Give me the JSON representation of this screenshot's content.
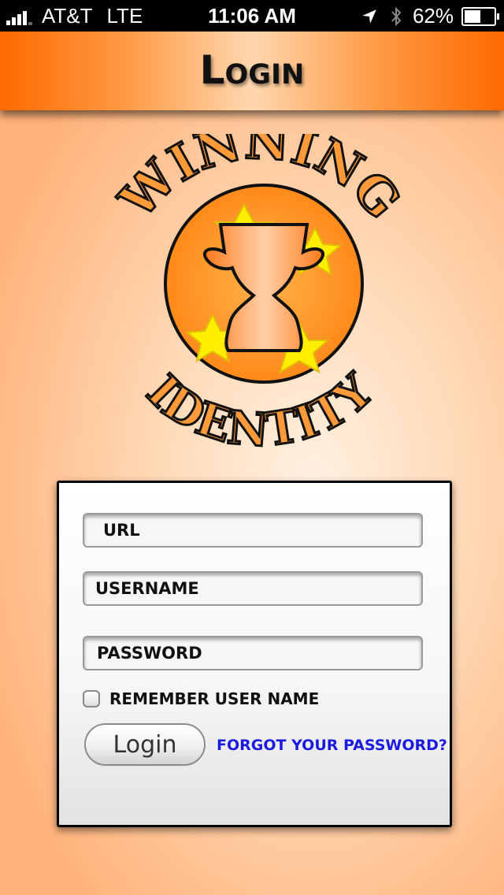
{
  "status_bar": {
    "carrier": "AT&T",
    "network": "LTE",
    "time": "11:06 AM",
    "battery": "62%",
    "battery_level": 0.62,
    "icons": [
      "signal-icon",
      "location-icon",
      "bluetooth-icon",
      "battery-icon"
    ]
  },
  "header": {
    "title": "Login"
  },
  "logo": {
    "name": "Winning Identity",
    "colors": {
      "orange": "#ff8a1a",
      "yellow": "#ffee00",
      "outline": "#111111"
    }
  },
  "form": {
    "url_placeholder": "URL",
    "username_placeholder": "USERNAME",
    "password_placeholder": "PASSWORD",
    "remember_label": "REMEMBER USER NAME",
    "remember_checked": false,
    "login_button": "Login",
    "forgot_link": "FORGOT YOUR PASSWORD?"
  },
  "colors": {
    "accent": "#ff6a00",
    "link": "#1a1ae0"
  }
}
